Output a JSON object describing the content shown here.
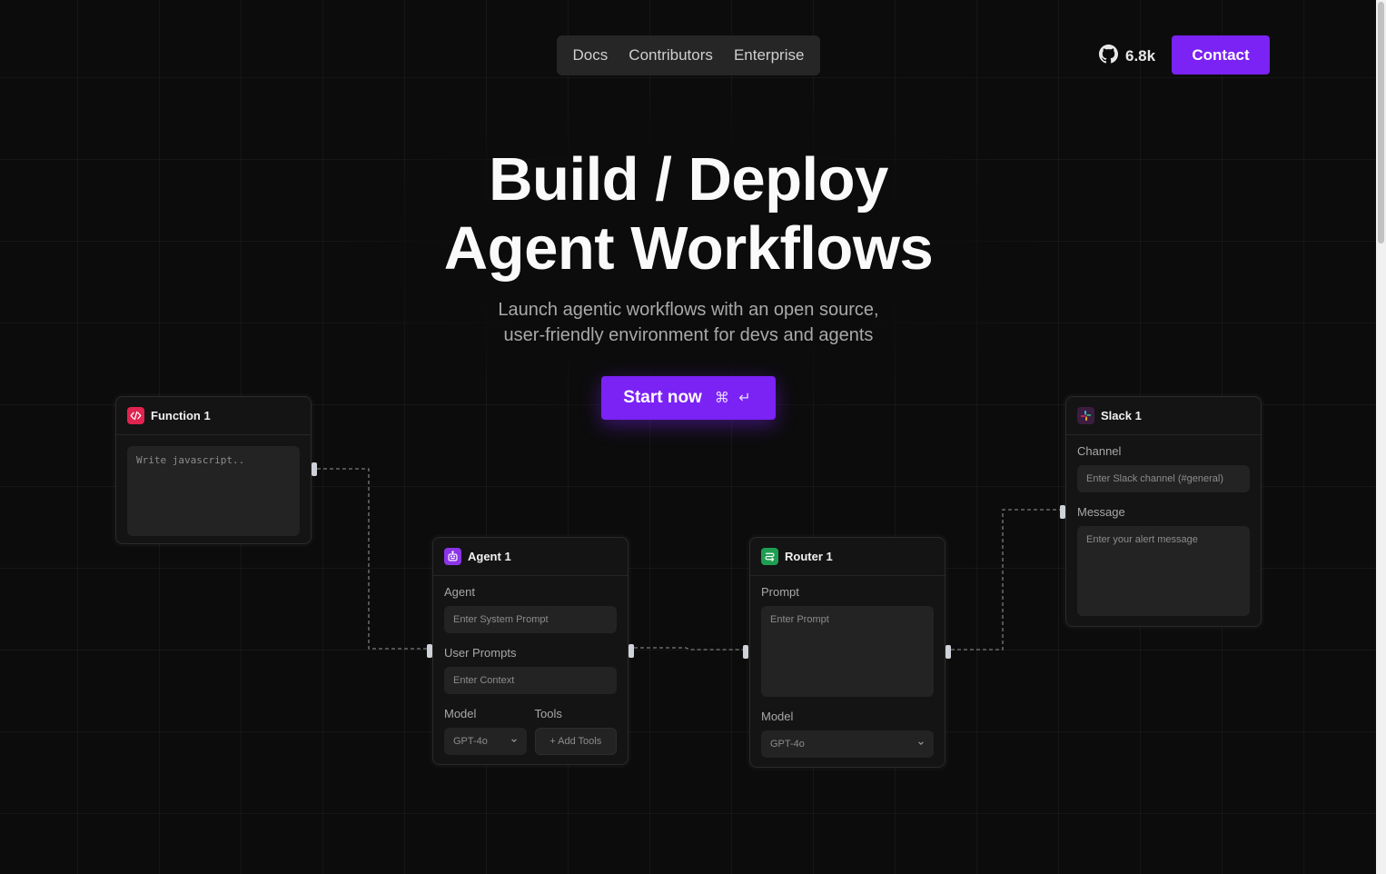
{
  "nav": {
    "links": [
      "Docs",
      "Contributors",
      "Enterprise"
    ],
    "github_stars": "6.8k",
    "contact_label": "Contact"
  },
  "hero": {
    "title_line1": "Build / Deploy",
    "title_line2": "Agent Workflows",
    "subtitle_line1": "Launch agentic workflows with an open source,",
    "subtitle_line2": "user-friendly environment for devs and agents",
    "cta_label": "Start now",
    "cta_shortcut": "⌘ ↵"
  },
  "cards": {
    "function": {
      "title": "Function 1",
      "code_placeholder": "Write javascript.."
    },
    "agent": {
      "title": "Agent 1",
      "agent_label": "Agent",
      "agent_placeholder": "Enter System Prompt",
      "prompts_label": "User Prompts",
      "prompts_placeholder": "Enter Context",
      "model_label": "Model",
      "model_value": "GPT-4o",
      "tools_label": "Tools",
      "tools_button": "+ Add Tools"
    },
    "router": {
      "title": "Router 1",
      "prompt_label": "Prompt",
      "prompt_placeholder": "Enter Prompt",
      "model_label": "Model",
      "model_value": "GPT-4o"
    },
    "slack": {
      "title": "Slack 1",
      "channel_label": "Channel",
      "channel_placeholder": "Enter Slack channel (#general)",
      "message_label": "Message",
      "message_placeholder": "Enter your alert message"
    }
  },
  "colors": {
    "accent": "#7b22f5",
    "function_icon": "#e0244f",
    "agent_icon": "#8b34e8",
    "router_icon": "#1f9e52"
  },
  "icons": {
    "github": "github-icon",
    "function": "code-icon",
    "agent": "robot-icon",
    "router": "route-icon",
    "slack": "slack-icon",
    "chevron": "chevron-down-icon"
  }
}
